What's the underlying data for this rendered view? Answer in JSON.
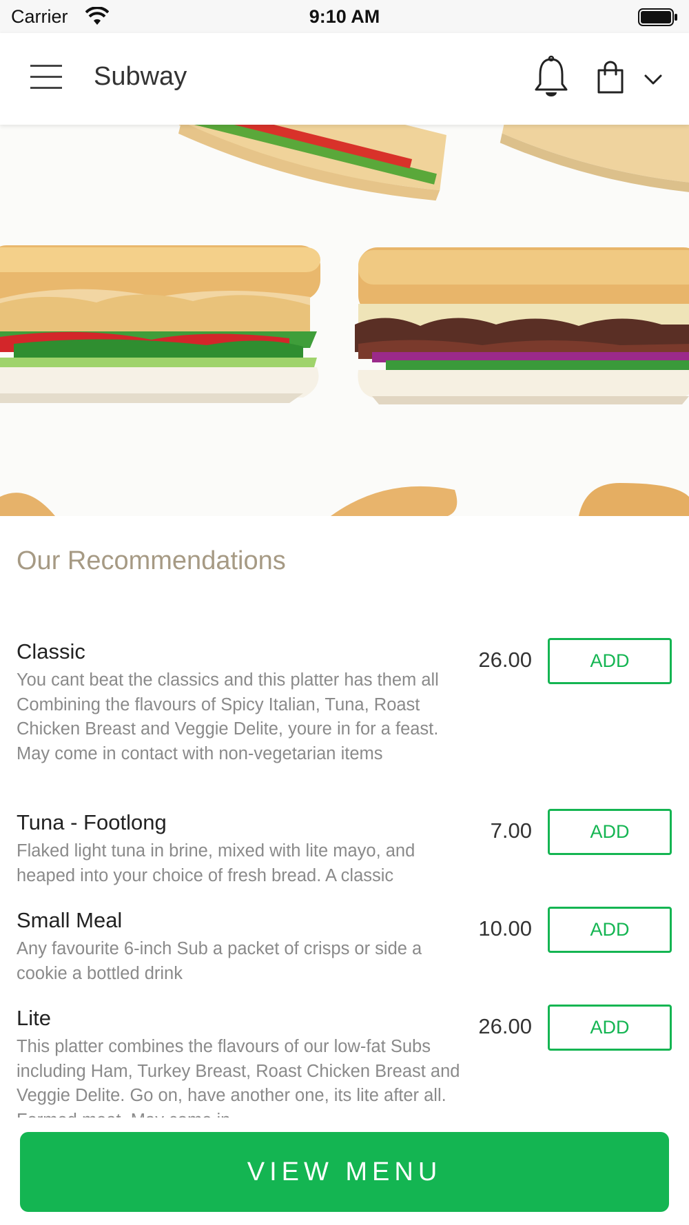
{
  "status_bar": {
    "carrier": "Carrier",
    "time": "9:10 AM",
    "icons": [
      "wifi-icon",
      "battery-icon"
    ]
  },
  "header": {
    "title": "Subway",
    "icons": [
      "hamburger-menu-icon",
      "bell-icon",
      "shopping-bag-icon",
      "chevron-down-icon"
    ]
  },
  "hero": {
    "image": "sandwiches-banner"
  },
  "recommendations": {
    "title": "Our Recommendations",
    "items": [
      {
        "name": "Classic",
        "description": "You cant beat the classics and this platter has them all Combining the flavours of Spicy Italian, Tuna, Roast Chicken Breast and Veggie Delite, youre in for a feast. May come in contact with non-vegetarian items",
        "price": "26.00",
        "button": "ADD"
      },
      {
        "name": "Tuna - Footlong",
        "description": "Flaked light tuna in brine, mixed with lite mayo, and heaped into your choice of fresh bread. A classic",
        "price": "7.00",
        "button": "ADD"
      },
      {
        "name": "Small Meal",
        "description": "Any favourite 6-inch Sub a packet of crisps or side a cookie a bottled drink",
        "price": "10.00",
        "button": "ADD"
      },
      {
        "name": "Lite",
        "description": "This platter combines the flavours of our low-fat Subs including Ham, Turkey Breast, Roast Chicken Breast and Veggie Delite. Go on, have another one, its lite after all. Formed meat. May come in",
        "price": "26.00",
        "button": "ADD"
      }
    ]
  },
  "footer": {
    "button": "VIEW MENU"
  },
  "colors": {
    "accent_green": "#14b552",
    "section_title": "#a69a84",
    "description_text": "#8a8a8a"
  }
}
